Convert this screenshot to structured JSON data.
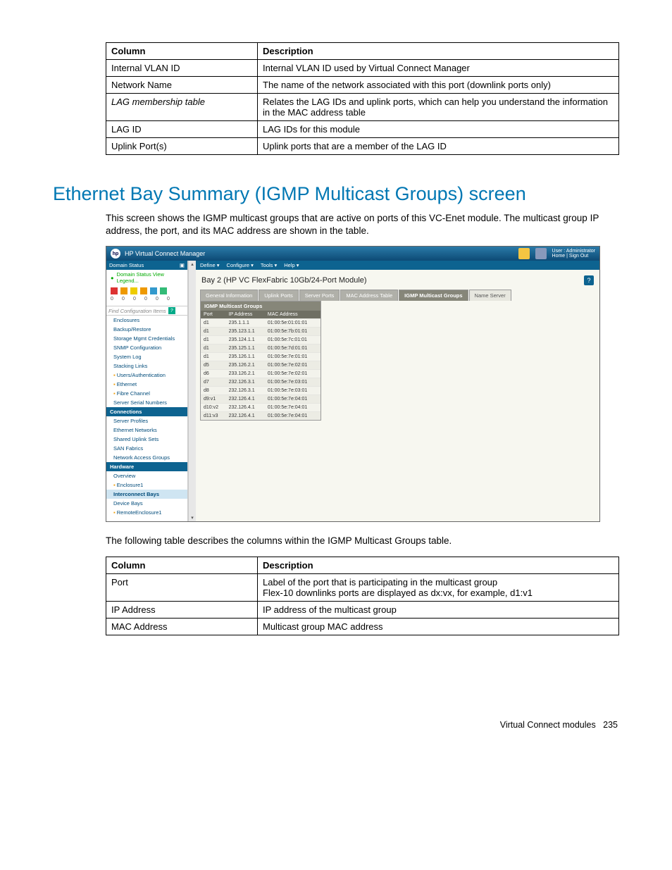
{
  "table1": {
    "head": {
      "c1": "Column",
      "c2": "Description"
    },
    "rows": [
      {
        "c1": "Internal VLAN ID",
        "c2": "Internal VLAN ID used by Virtual Connect Manager"
      },
      {
        "c1": "Network Name",
        "c2": "The name of the network associated with this port (downlink ports only)"
      },
      {
        "c1": "LAG membership table",
        "c1style": "italic",
        "c2": "Relates the LAG IDs and uplink ports, which can help you understand the information in the MAC address table"
      },
      {
        "c1": "LAG ID",
        "c2": "LAG IDs for this module"
      },
      {
        "c1": "Uplink Port(s)",
        "c2": "Uplink ports that are a member of the LAG ID"
      }
    ]
  },
  "heading": "Ethernet Bay Summary (IGMP Multicast Groups) screen",
  "para1": "This screen shows the IGMP multicast groups that are active on ports of this VC-Enet module. The multicast group IP address, the port, and its MAC address are shown in the table.",
  "para2": "The following table describes the columns within the IGMP Multicast Groups table.",
  "table2": {
    "head": {
      "c1": "Column",
      "c2": "Description"
    },
    "rows": [
      {
        "c1": "Port",
        "c2": "Label of the port that is participating in the multicast group\nFlex-10 downlinks ports are displayed as dx:vx, for example, d1:v1"
      },
      {
        "c1": "IP Address",
        "c2": "IP address of the multicast group"
      },
      {
        "c1": "MAC Address",
        "c2": "Multicast group MAC address"
      }
    ]
  },
  "footer": {
    "section": "Virtual Connect modules",
    "page": "235"
  },
  "shot": {
    "appTitle": "HP Virtual Connect Manager",
    "userLabel": "User : Administrator",
    "userLinks": "Home | Sign Out",
    "menubar": [
      "Define ▾",
      "Configure ▾",
      "Tools ▾",
      "Help ▾"
    ],
    "mainTitle": "Bay 2 (HP VC FlexFabric 10Gb/24-Port Module)",
    "tabs": [
      "General Information",
      "Uplink Ports",
      "Server Ports",
      "MAC Address Table",
      "IGMP Multicast Groups",
      "Name Server"
    ],
    "activeTab": 4,
    "panelTitle": "IGMP Multicast Groups",
    "gridHead": [
      "Port",
      "IP Address",
      "MAC Address"
    ],
    "gridRows": [
      [
        "d1",
        "235.1.1.1",
        "01:00:5e:01:01:01"
      ],
      [
        "d1",
        "235.123.1.1",
        "01:00:5e:7b:01:01"
      ],
      [
        "d1",
        "235.124.1.1",
        "01:00:5e:7c:01:01"
      ],
      [
        "d1",
        "235.125.1.1",
        "01:00:5e:7d:01:01"
      ],
      [
        "d1",
        "235.126.1.1",
        "01:00:5e:7e:01:01"
      ],
      [
        "d5",
        "235.126.2.1",
        "01:00:5e:7e:02:01"
      ],
      [
        "d6",
        "233.126.2.1",
        "01:00:5e:7e:02:01"
      ],
      [
        "d7",
        "232.126.3.1",
        "01:00:5e:7e:03:01"
      ],
      [
        "d8",
        "232.126.3.1",
        "01:00:5e:7e:03:01"
      ],
      [
        "d9:v1",
        "232.126.4.1",
        "01:00:5e:7e:04:01"
      ],
      [
        "d10:v2",
        "232.126.4.1",
        "01:00:5e:7e:04:01"
      ],
      [
        "d11:v3",
        "232.126.4.1",
        "01:00:5e:7e:04:01"
      ]
    ],
    "sidebar": {
      "statusHead": "Domain Status",
      "statusRow": "Domain Status   View Legend...",
      "findPlaceholder": "Find Configuration Items",
      "items": [
        "Enclosures",
        "Backup/Restore",
        "Storage Mgmt Credentials",
        "SNMP Configuration",
        "System Log",
        "Stacking Links"
      ],
      "cats": [
        {
          "icon": true,
          "label": "Users/Authentication"
        },
        {
          "icon": true,
          "label": "Ethernet"
        },
        {
          "icon": true,
          "label": "Fibre Channel"
        }
      ],
      "serverSerial": "Server Serial Numbers",
      "connHead": "Connections",
      "connItems": [
        "Server Profiles",
        "Ethernet Networks",
        "Shared Uplink Sets",
        "SAN Fabrics",
        "Network Access Groups"
      ],
      "hwHead": "Hardware",
      "hwItems": [
        "Overview"
      ],
      "hwEnc": "Enclosure1",
      "hwSel": "Interconnect Bays",
      "hwDev": "Device Bays",
      "hwRemote": "RemoteEnclosure1"
    }
  }
}
